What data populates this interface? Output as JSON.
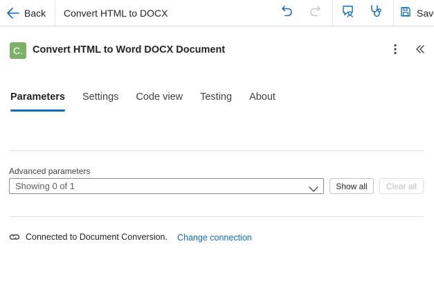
{
  "toolbar": {
    "back_label": "Back",
    "flow_title": "Convert HTML to DOCX",
    "save_label": "Save",
    "icons": [
      "arrow-left-icon",
      "undo-icon",
      "redo-icon",
      "comment-person-icon",
      "stethoscope-icon",
      "save-icon"
    ],
    "accent": "#0f6cbd"
  },
  "header": {
    "app_icon_letter": "C.",
    "app_icon_color": "#7fb069",
    "title": "Convert HTML to Word DOCX Document"
  },
  "tabs": [
    {
      "label": "Parameters",
      "active": true
    },
    {
      "label": "Settings",
      "active": false
    },
    {
      "label": "Code view",
      "active": false
    },
    {
      "label": "Testing",
      "active": false
    },
    {
      "label": "About",
      "active": false
    }
  ],
  "advanced": {
    "label": "Advanced parameters",
    "dropdown_value": "Showing 0 of 1",
    "show_all_label": "Show all",
    "clear_all_label": "Clear all"
  },
  "connection": {
    "text": "Connected to Document Conversion.",
    "change_label": "Change connection"
  }
}
